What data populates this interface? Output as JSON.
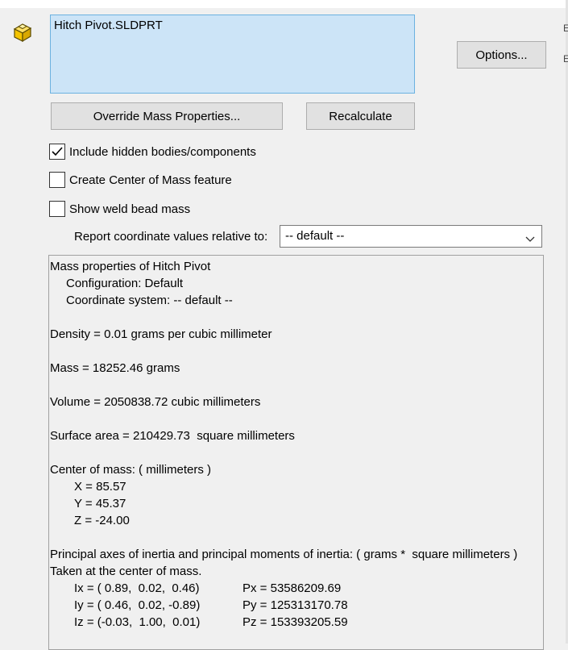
{
  "selection": {
    "item": "Hitch Pivot.SLDPRT"
  },
  "buttons": {
    "options": "Options...",
    "override": "Override Mass Properties...",
    "recalculate": "Recalculate"
  },
  "checkboxes": [
    {
      "label": "Include hidden bodies/components",
      "checked": true
    },
    {
      "label": "Create Center of Mass feature",
      "checked": false
    },
    {
      "label": "Show weld bead mass",
      "checked": false
    }
  ],
  "report": {
    "label": "Report coordinate values relative to:",
    "selected": "-- default --"
  },
  "results": {
    "title": "Mass properties of Hitch Pivot",
    "configuration": "Configuration: Default",
    "coordinate_system": "Coordinate system: -- default --",
    "density": "Density = 0.01 grams per cubic millimeter",
    "mass": "Mass = 18252.46 grams",
    "volume": "Volume = 2050838.72 cubic millimeters",
    "surface_area": "Surface area = 210429.73  square millimeters",
    "com_header": "Center of mass: ( millimeters )",
    "com_x": "X = 85.57",
    "com_y": "Y = 45.37",
    "com_z": "Z = -24.00",
    "principal_header": "Principal axes of inertia and principal moments of inertia: ( grams *  square millimeters )",
    "taken_at": "Taken at the center of mass.",
    "ix": "Ix = ( 0.89,  0.02,  0.46)",
    "iy": "Iy = ( 0.46,  0.02, -0.89)",
    "iz": "Iz = (-0.03,  1.00,  0.01)",
    "px": "Px = 53586209.69",
    "py": "Py = 125313170.78",
    "pz": "Pz = 153393205.59"
  },
  "icons": {
    "part": "part-icon",
    "check": "checkmark-icon",
    "dropdown": "chevron-down-icon"
  },
  "colors": {
    "selection_bg": "#cce4f7",
    "selection_border": "#6cb2e0",
    "button_bg": "#e1e1e1",
    "part_icon": "#f5c400"
  }
}
